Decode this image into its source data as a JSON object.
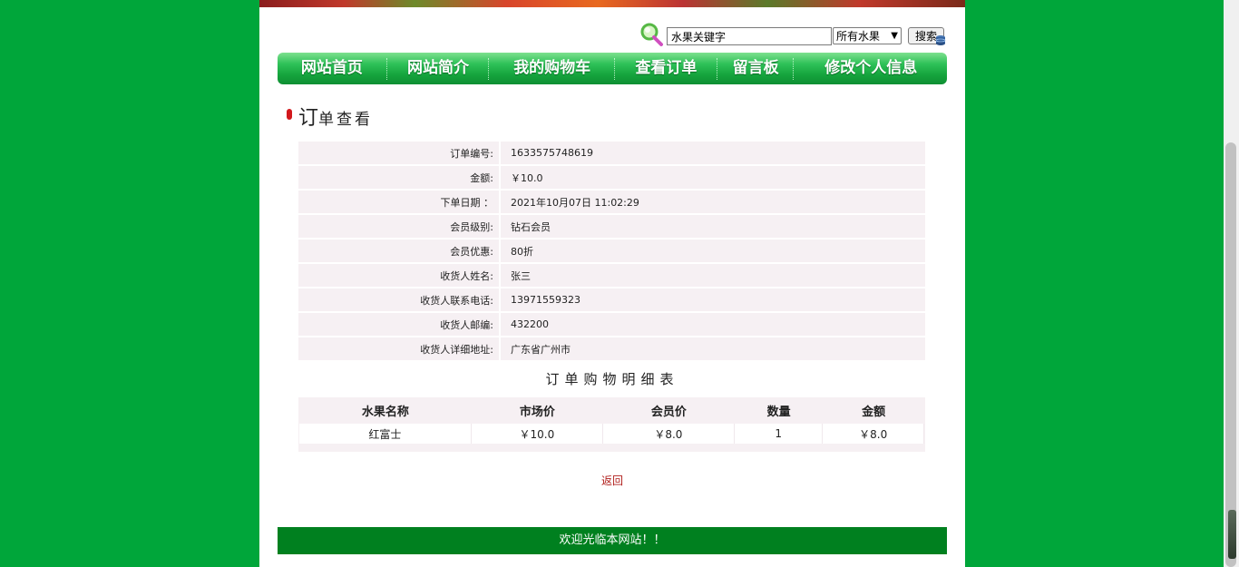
{
  "search": {
    "keyword_value": "水果关键字",
    "category_selected": "所有水果",
    "submit_label": "搜索"
  },
  "nav": {
    "items": [
      {
        "label": "网站首页"
      },
      {
        "label": "网站简介"
      },
      {
        "label": "我的购物车"
      },
      {
        "label": "查看订单"
      },
      {
        "label": "留言板"
      },
      {
        "label": "修改个人信息"
      }
    ]
  },
  "section": {
    "title_first": "订",
    "title_rest": "单查看"
  },
  "order": {
    "rows": [
      {
        "label": "订单编号:",
        "value": "1633575748619"
      },
      {
        "label": "金额:",
        "value": "￥10.0"
      },
      {
        "label": "下单日期 ：",
        "value": "2021年10月07日 11:02:29"
      },
      {
        "label": "会员级别:",
        "value": "钻石会员"
      },
      {
        "label": "会员优惠:",
        "value": "80折"
      },
      {
        "label": "收货人姓名:",
        "value": "张三"
      },
      {
        "label": "收货人联系电话:",
        "value": "13971559323"
      },
      {
        "label": "收货人邮编:",
        "value": "432200"
      },
      {
        "label": "收货人详细地址:",
        "value": "广东省广州市"
      }
    ]
  },
  "detail": {
    "title": "订单购物明细表",
    "headers": [
      "水果名称",
      "市场价",
      "会员价",
      "数量",
      "金额"
    ],
    "rows": [
      [
        "红富士",
        "￥10.0",
        "￥8.0",
        "1",
        "￥8.0"
      ]
    ]
  },
  "back_label": "返回",
  "footer_text": "欢迎光临本网站！！",
  "colors": {
    "page_bg": "#00a63a",
    "footer_bg": "#00801f",
    "row_bg": "#f6f0f3",
    "link_red": "#b1201d"
  }
}
